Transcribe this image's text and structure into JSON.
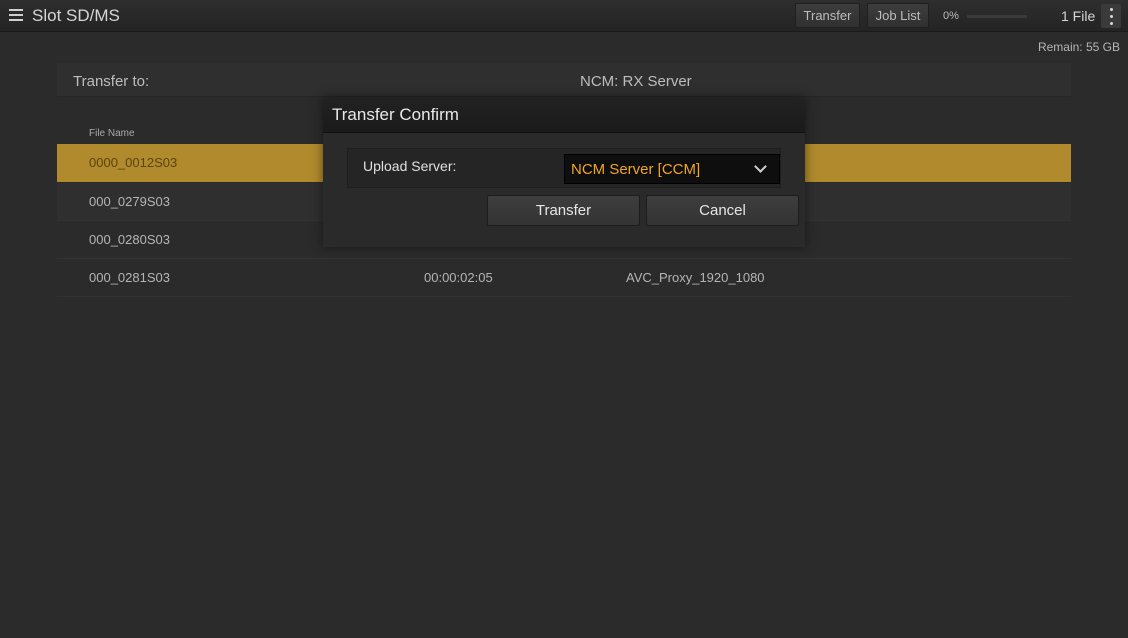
{
  "header": {
    "title": "Slot SD/MS",
    "transfer_label": "Transfer",
    "job_list_label": "Job List",
    "progress_text": "0%",
    "progress_value": 0,
    "file_count": "1 File"
  },
  "remain": "Remain: 55 GB",
  "transfer_to": {
    "label": "Transfer to:",
    "value": "NCM: RX Server"
  },
  "table": {
    "column_file_name": "File Name",
    "rows": [
      {
        "name": "0000_0012S03",
        "duration": "",
        "format": "",
        "selected": true
      },
      {
        "name": "000_0279S03",
        "duration": "",
        "format": ""
      },
      {
        "name": "000_0280S03",
        "duration": "",
        "format": ""
      },
      {
        "name": "000_0281S03",
        "duration": "00:00:02:05",
        "format": "AVC_Proxy_1920_1080"
      }
    ]
  },
  "dialog": {
    "title": "Transfer Confirm",
    "server_label": "Upload Server:",
    "server_value": "NCM Server [CCM]",
    "transfer_button": "Transfer",
    "cancel_button": "Cancel"
  },
  "colors": {
    "selected_row": "#b08a2c",
    "server_value_text": "#f0a428"
  },
  "icons": {
    "menu": "hamburger-menu-icon",
    "more": "vertical-dots-icon",
    "dropdown": "chevron-down-icon"
  }
}
